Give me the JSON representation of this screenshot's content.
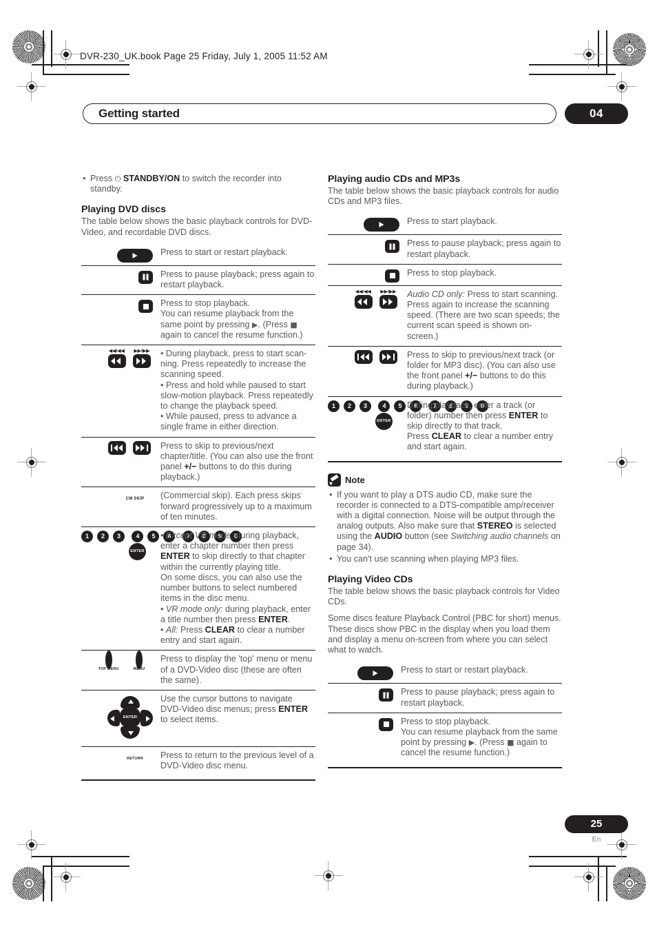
{
  "print_marks": {
    "file_info": "DVR-230_UK.book  Page 25  Friday, July 1, 2005  11:52 AM"
  },
  "header": {
    "chapter_title": "Getting started",
    "chapter_number": "04"
  },
  "footer": {
    "page_number": "25",
    "language_code": "En"
  },
  "left_column": {
    "intro_bullets": [
      {
        "pre": "Press ",
        "icon": "⏻",
        "bold": "STANDBY/ON",
        "post": " to switch the recorder into standby."
      }
    ],
    "dvd_section": {
      "heading": "Playing DVD discs",
      "intro": "The table below shows the basic playback controls for DVD-Video, and recordable DVD discs.",
      "rows": [
        {
          "icon": "play-button",
          "text": "Press to start or restart playback."
        },
        {
          "icon": "pause-button",
          "text": "Press to pause playback; press again to restart playback."
        },
        {
          "icon": "stop-button",
          "text": "Press to stop playback.\nYou can resume playback from the same point by pressing ▶. (Press ■ again to cancel the resume function.)"
        },
        {
          "icon": "scan-buttons",
          "text": "• During playback, press to start scanning. Press repeatedly to increase the scanning speed.\n• Press and hold while paused to start slow-motion playback. Press repeatedly to change the playback speed.\n• While paused, press to advance a single frame in either direction."
        },
        {
          "icon": "skip-buttons",
          "text": "Press to skip to previous/next chapter/title. (You can also use the front panel +/− buttons to do this during playback.)"
        },
        {
          "icon": "cm-skip-button",
          "text": "(Commercial skip). Each press skips forward progressively up to a maximum of ten minutes."
        },
        {
          "icon": "number-pad",
          "text": "• Except VR mode: during playback, enter a chapter number then press ENTER to skip directly to that chapter within the currently playing title.\nOn some discs, you can also use the number buttons to select numbered items in the disc menu.\n• VR mode only: during playback, enter a title number then press ENTER.\n• All: Press CLEAR to clear a number entry and start again."
        },
        {
          "icon": "top-menu-menu-buttons",
          "text": "Press to display the 'top' menu or menu of a DVD-Video disc (these are often the same)."
        },
        {
          "icon": "cursor-pad",
          "text": "Use the cursor buttons to navigate DVD-Video disc menus; press ENTER to select items."
        },
        {
          "icon": "return-button",
          "text": "Press to return to the previous level of a DVD-Video disc menu."
        }
      ],
      "labels": {
        "cm_skip": "CM SKIP",
        "top_menu": "TOP MENU",
        "menu": "MENU",
        "return": "RETURN",
        "enter": "ENTER",
        "scan_rev_small": "◀◀/◀◀",
        "scan_fwd_small": "▶▶/▶▶"
      },
      "numbers": [
        "1",
        "2",
        "3",
        "4",
        "5",
        "6",
        "7",
        "8",
        "9",
        "0"
      ]
    }
  },
  "right_column": {
    "audio_section": {
      "heading": "Playing audio CDs and MP3s",
      "intro": "The table below shows the basic playback controls for audio CDs and MP3 files.",
      "rows": [
        {
          "icon": "play-button",
          "text": "Press to start  playback."
        },
        {
          "icon": "pause-button",
          "text": "Press to pause playback; press again to restart playback."
        },
        {
          "icon": "stop-button",
          "text": "Press to stop playback."
        },
        {
          "icon": "scan-buttons",
          "text": "Audio CD only: Press to start scanning. Press again to increase the scanning speed. (There are two scan speeds; the current scan speed is shown on-screen.)"
        },
        {
          "icon": "skip-buttons",
          "text": "Press to skip to previous/next track (or folder for MP3 disc). (You can also use the front panel +/− buttons to do this during playback.)"
        },
        {
          "icon": "number-pad",
          "text": "During playback, enter a track (or folder) number then press ENTER to skip directly to that track.\nPress CLEAR to clear a number entry and start again."
        }
      ]
    },
    "note": {
      "title": "Note",
      "bullets": [
        "If you want to play a DTS audio CD, make sure the recorder is connected to a DTS-compatible amp/receiver with a digital connection. Noise will be output through the analog outputs. Also make sure that STEREO is selected using the AUDIO button (see Switching audio channels on page 34).",
        "You can't use scanning when playing MP3 files."
      ]
    },
    "videocd_section": {
      "heading": "Playing Video CDs",
      "intro": "The table below shows the basic playback controls for Video CDs.",
      "intro2": "Some discs feature Playback Control (PBC for short) menus. These discs show PBC in the display when you load them and display a menu on-screen from where you can select what to watch.",
      "rows": [
        {
          "icon": "play-button",
          "text": "Press to start or restart playback."
        },
        {
          "icon": "pause-button",
          "text": "Press to pause playback; press again to restart playback."
        },
        {
          "icon": "stop-button",
          "text": "Press to stop playback.\nYou can resume playback from the same point by pressing ▶. (Press ■ again to cancel the resume function.)"
        }
      ]
    }
  },
  "colors": {
    "ink": "#231f20",
    "body_text": "#58595b",
    "mark_gray": "#a7a9ac"
  }
}
